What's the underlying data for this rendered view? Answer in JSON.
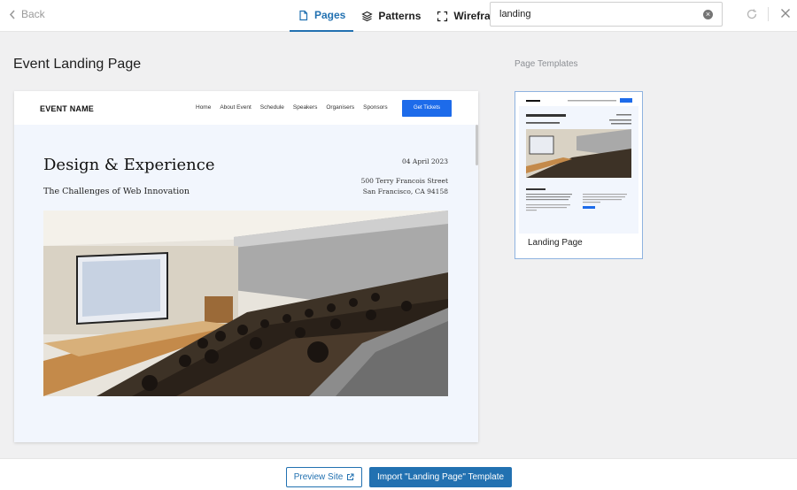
{
  "topbar": {
    "back_label": "Back",
    "tabs": [
      {
        "label": "Pages",
        "icon": "page-icon",
        "active": true
      },
      {
        "label": "Patterns",
        "icon": "layers-icon",
        "active": false
      },
      {
        "label": "Wireframes",
        "icon": "frame-icon",
        "active": false
      }
    ],
    "search": {
      "value": "landing"
    }
  },
  "page_title": "Event Landing Page",
  "templates": {
    "heading": "Page Templates",
    "items": [
      {
        "label": "Landing Page",
        "selected": true
      }
    ]
  },
  "preview": {
    "logo": "EVENT NAME",
    "nav": [
      "Home",
      "About Event",
      "Schedule",
      "Speakers",
      "Organisers",
      "Sponsors"
    ],
    "cta": "Get Tickets",
    "heading": "Design & Experience",
    "subheading": "The Challenges of Web Innovation",
    "date": "04 April 2023",
    "address_line1": "500 Terry Francois Street",
    "address_line2": "San Francisco, CA 94158"
  },
  "actions": {
    "preview_site": "Preview Site",
    "import": "Import \"Landing Page\" Template"
  },
  "colors": {
    "accent": "#2271b1",
    "cta_blue": "#1d6bea",
    "preview_bg": "#f2f6fd"
  }
}
